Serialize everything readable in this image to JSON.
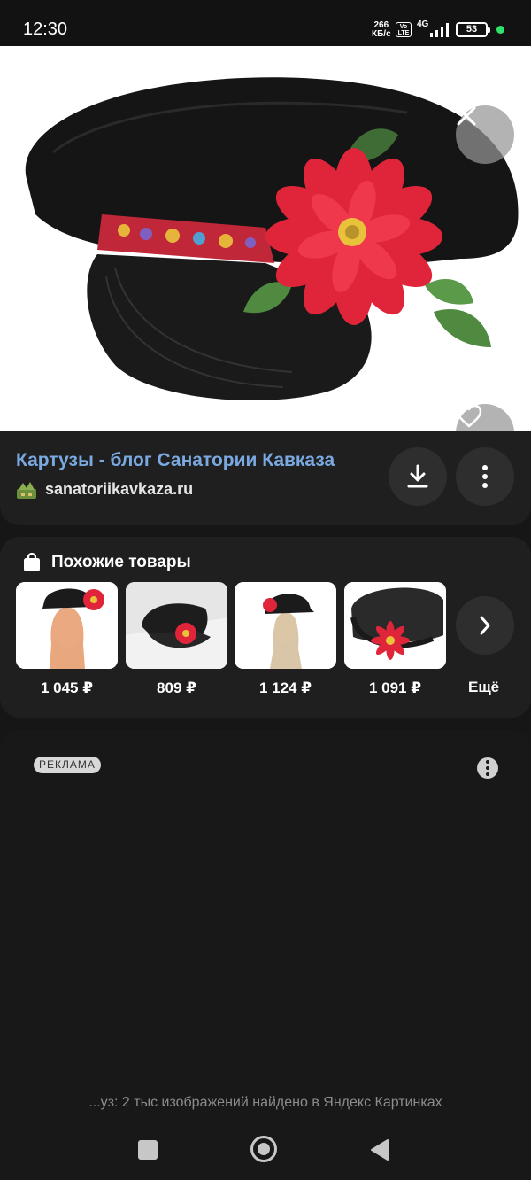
{
  "status_bar": {
    "time": "12:30",
    "speed_value": "266",
    "speed_unit": "КБ/с",
    "volte_line1": "Vo",
    "volte_line2": "LTE",
    "network": "4G",
    "battery": "53"
  },
  "viewer": {
    "close_icon": "close-icon",
    "favorite_icon": "heart-icon"
  },
  "info": {
    "title": "Картузы - блог Санатории Кавказа",
    "site": "sanatoriikavkaza.ru",
    "download_icon": "download-icon",
    "more_icon": "vertical-dots-icon"
  },
  "similar": {
    "title": "Похожие товары",
    "items": [
      {
        "price": "1 045 ₽"
      },
      {
        "price": "809 ₽"
      },
      {
        "price": "1 124 ₽"
      },
      {
        "price": "1 091 ₽"
      }
    ],
    "more_label": "Ещё"
  },
  "ad": {
    "badge": "РЕКЛАМА"
  },
  "footer": {
    "text": "...уз: 2 тыс изображений найдено в Яндекс Картинках"
  },
  "colors": {
    "title_link": "#7aa8e0",
    "background": "#161616",
    "card": "#1f1f1f",
    "flower_red": "#e0253a"
  }
}
